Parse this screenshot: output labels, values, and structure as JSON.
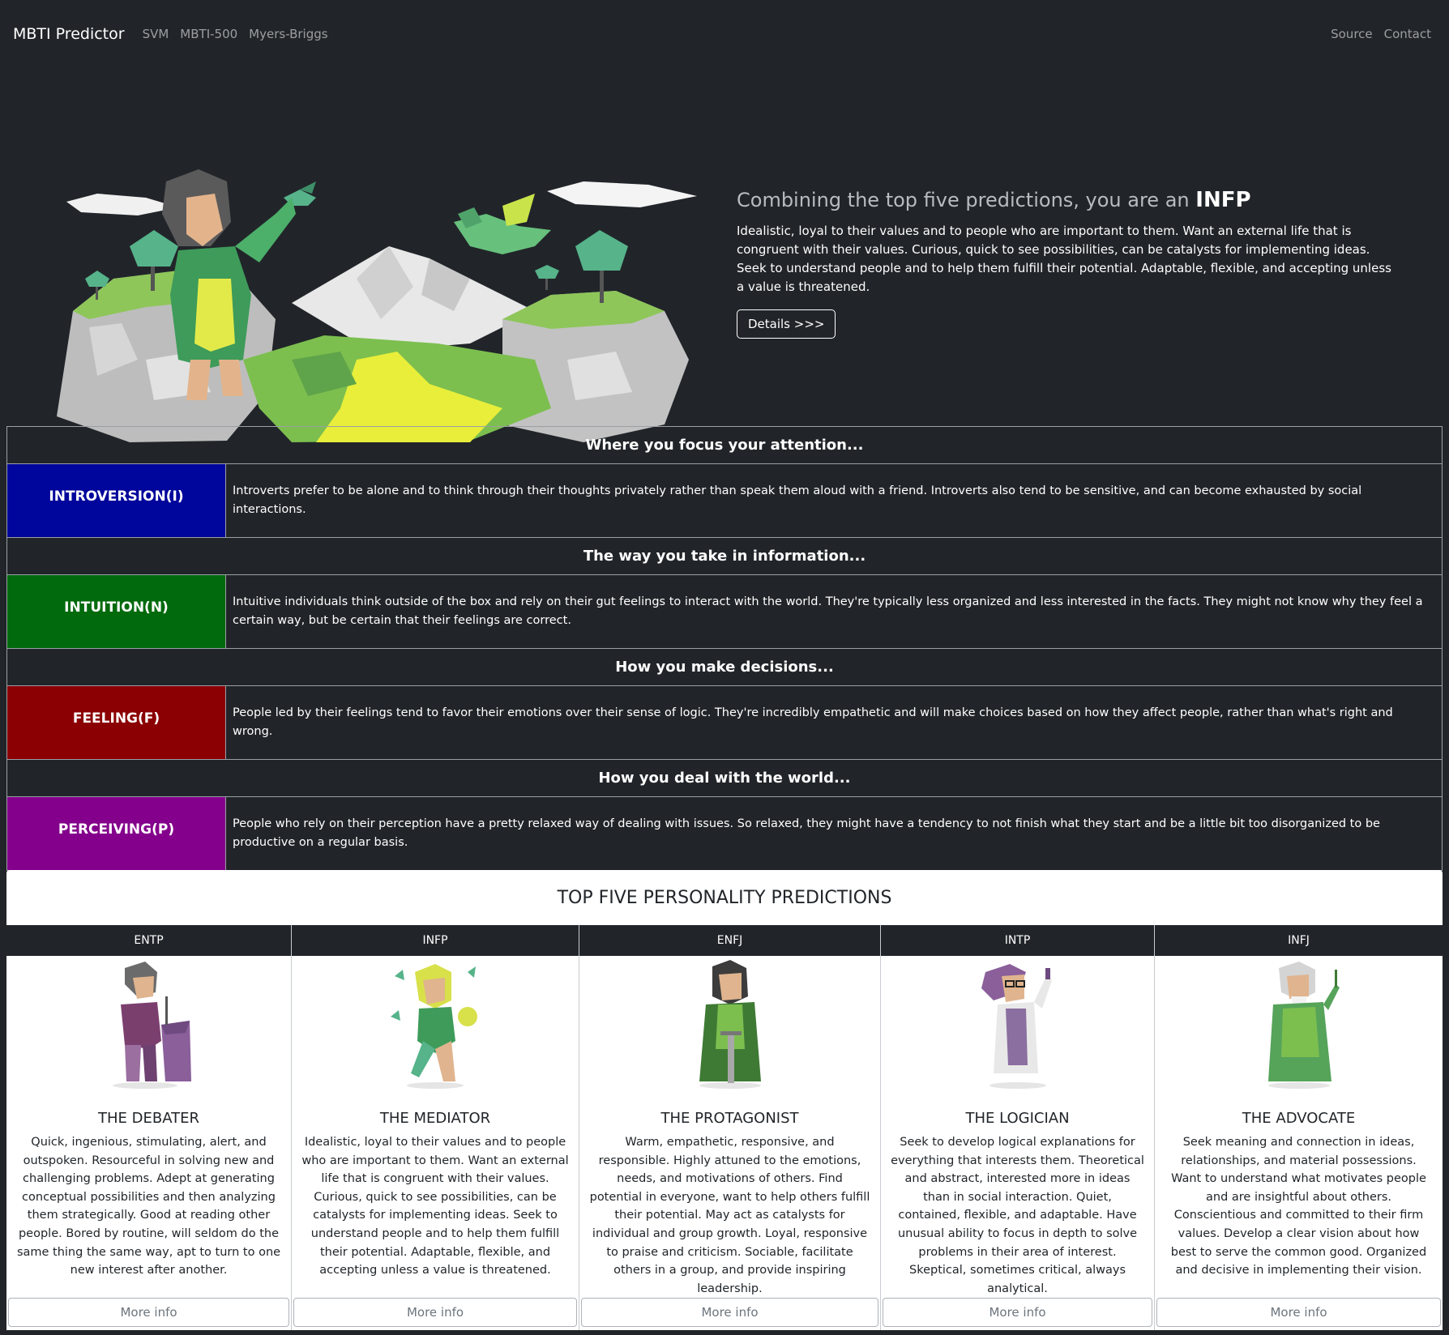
{
  "navbar": {
    "brand": "MBTI Predictor",
    "links": [
      "SVM",
      "MBTI-500",
      "Myers-Briggs"
    ],
    "right_links": [
      "Source",
      "Contact"
    ]
  },
  "hero": {
    "title_prefix": "Combining the top five predictions, you are an",
    "type": "INFP",
    "description": "Idealistic, loyal to their values and to people who are important to them. Want an external life that is congruent with their values. Curious, quick to see possibilities, can be catalysts for implementing ideas. Seek to understand people and to help them fulfill their potential. Adaptable, flexible, and accepting unless a value is threatened.",
    "details_label": "Details >>>"
  },
  "dimensions": [
    {
      "header": "Where you focus your attention...",
      "label": "INTROVERSION(I)",
      "color": "#00069b",
      "text": "Introverts prefer to be alone and to think through their thoughts privately rather than speak them aloud with a friend. Introverts also tend to be sensitive, and can become exhausted by social interactions."
    },
    {
      "header": "The way you take in information...",
      "label": "INTUITION(N)",
      "color": "#006a0c",
      "text": "Intuitive individuals think outside of the box and rely on their gut feelings to interact with the world. They're typically less organized and less interested in the facts. They might not know why they feel a certain way, but be certain that their feelings are correct."
    },
    {
      "header": "How you make decisions...",
      "label": "FEELING(F)",
      "color": "#8b0002",
      "text": "People led by their feelings tend to favor their emotions over their sense of logic. They're incredibly empathetic and will make choices based on how they affect people, rather than what's right and wrong."
    },
    {
      "header": "How you deal with the world...",
      "label": "PERCEIVING(P)",
      "color": "#84008c",
      "text": "People who rely on their perception have a pretty relaxed way of dealing with issues. So relaxed, they might have a tendency to not finish what they start and be a little bit too disorganized to be productive on a regular basis."
    }
  ],
  "top_five_title": "TOP FIVE PERSONALITY PREDICTIONS",
  "predictions": [
    {
      "type": "ENTP",
      "name": "THE DEBATER",
      "description": "Quick, ingenious, stimulating, alert, and outspoken. Resourceful in solving new and challenging problems. Adept at generating conceptual possibilities and then analyzing them strategically. Good at reading other people. Bored by routine, will seldom do the same thing the same way, apt to turn to one new interest after another.",
      "button": "More info"
    },
    {
      "type": "INFP",
      "name": "THE MEDIATOR",
      "description": "Idealistic, loyal to their values and to people who are important to them. Want an external life that is congruent with their values. Curious, quick to see possibilities, can be catalysts for implementing ideas. Seek to understand people and to help them fulfill their potential. Adaptable, flexible, and accepting unless a value is threatened.",
      "button": "More info"
    },
    {
      "type": "ENFJ",
      "name": "THE PROTAGONIST",
      "description": "Warm, empathetic, responsive, and responsible. Highly attuned to the emotions, needs, and motivations of others. Find potential in everyone, want to help others fulfill their potential. May act as catalysts for individual and group growth. Loyal, responsive to praise and criticism. Sociable, facilitate others in a group, and provide inspiring leadership.",
      "button": "More info"
    },
    {
      "type": "INTP",
      "name": "THE LOGICIAN",
      "description": "Seek to develop logical explanations for everything that interests them. Theoretical and abstract, interested more in ideas than in social interaction. Quiet, contained, flexible, and adaptable. Have unusual ability to focus in depth to solve problems in their area of interest. Skeptical, sometimes critical, always analytical.",
      "button": "More info"
    },
    {
      "type": "INFJ",
      "name": "THE ADVOCATE",
      "description": "Seek meaning and connection in ideas, relationships, and material possessions. Want to understand what motivates people and are insightful about others. Conscientious and committed to their firm values. Develop a clear vision about how best to serve the common good. Organized and decisive in implementing their vision.",
      "button": "More info"
    }
  ]
}
